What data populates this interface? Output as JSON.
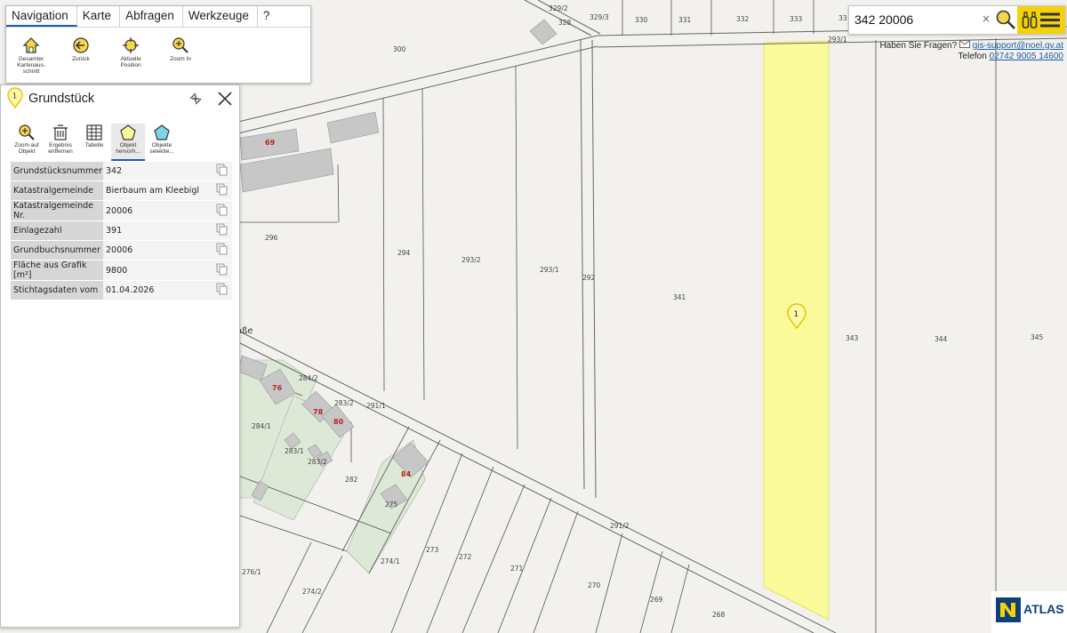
{
  "menu": {
    "tabs": [
      "Navigation",
      "Karte",
      "Abfragen",
      "Werkzeuge",
      "?"
    ],
    "tools": [
      {
        "label": "Gesamter\nKartenaus-\nschnitt",
        "icon": "home-icon"
      },
      {
        "label": "Zurück",
        "icon": "back-arrow-icon"
      },
      {
        "label": "Aktuelle\nPosition",
        "icon": "crosshair-icon"
      },
      {
        "label": "Zoom In",
        "icon": "zoom-in-icon"
      }
    ]
  },
  "panel": {
    "marker": "1",
    "title": "Grundstück",
    "tools": [
      {
        "label": "Zoom auf\nObjekt",
        "icon": "zoom-to-object-icon"
      },
      {
        "label": "Ergebnis\nentfernen",
        "icon": "trash-icon"
      },
      {
        "label": "Tabelle",
        "icon": "table-icon"
      },
      {
        "label": "Objekt\nhervorh...",
        "icon": "highlight-object-icon"
      },
      {
        "label": "Objekte\nselektie...",
        "icon": "select-objects-icon"
      }
    ],
    "rows": [
      {
        "key": "Grundstücksnummer",
        "value": "342"
      },
      {
        "key": "Katastralgemeinde",
        "value": "Bierbaum am Kleebigl"
      },
      {
        "key": "Katastralgemeinde Nr.",
        "value": "20006"
      },
      {
        "key": "Einlagezahl",
        "value": "391"
      },
      {
        "key": "Grundbuchsnummer",
        "value": "20006"
      },
      {
        "key": "Fläche aus Grafik [m²]",
        "value": "9800"
      },
      {
        "key": "Stichtagsdaten vom",
        "value": "01.04.2026"
      }
    ]
  },
  "search": {
    "value": "342 20006",
    "clear": "×"
  },
  "help": {
    "question": "Haben Sie Fragen?",
    "email": "gis-support@noel.gv.at",
    "phone_label": "Telefon",
    "phone": "02742 9005 14600"
  },
  "logo": {
    "text": "ATLAS"
  },
  "map": {
    "marker": "1",
    "parcels": [
      "329/2",
      "328",
      "329/3",
      "330",
      "331",
      "332",
      "333",
      "33",
      "293/1",
      "300",
      "296",
      "294",
      "293/2",
      "293/1",
      "292",
      "341",
      "343",
      "344",
      "345",
      "284/2",
      "283/2",
      "291/1",
      "284/1",
      "283/1",
      "283/2",
      "282",
      "275",
      "274/1",
      "273",
      "272",
      "271",
      "270",
      "269",
      "268",
      "291/2",
      "276/1",
      "274/2"
    ],
    "houses": [
      "69",
      "76",
      "78",
      "80",
      "84"
    ],
    "street_fragment": "aße"
  },
  "colors": {
    "accent": "#1a5fa6",
    "highlight": "#fafa9a",
    "search_button": "#f4d10a",
    "house": "#c7c7c7"
  }
}
